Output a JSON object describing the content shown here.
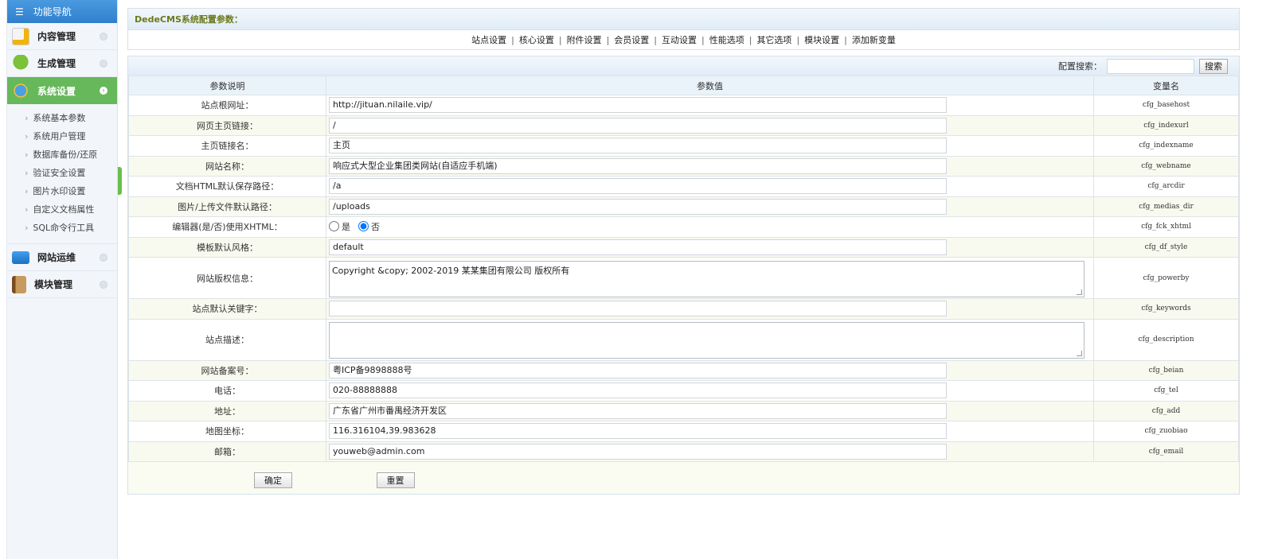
{
  "sidebar": {
    "title": "功能导航",
    "items": [
      {
        "label": "内容管理"
      },
      {
        "label": "生成管理"
      },
      {
        "label": "系统设置"
      },
      {
        "label": "网站运维"
      },
      {
        "label": "模块管理"
      }
    ],
    "submenu": [
      "系统基本参数",
      "系统用户管理",
      "数据库备份/还原",
      "验证安全设置",
      "图片水印设置",
      "自定义文档属性",
      "SQL命令行工具"
    ]
  },
  "header": {
    "title": "DedeCMS系统配置参数：",
    "tabs": [
      "站点设置",
      "核心设置",
      "附件设置",
      "会员设置",
      "互动设置",
      "性能选项",
      "其它选项",
      "模块设置",
      "添加新变量"
    ]
  },
  "search": {
    "label": "配置搜索：",
    "value": "",
    "button": "搜索"
  },
  "table": {
    "columns": [
      "参数说明",
      "参数值",
      "变量名"
    ],
    "rows": [
      {
        "label": "站点根网址：",
        "value": "http://jituan.nilaile.vip/",
        "var": "cfg_basehost",
        "type": "text"
      },
      {
        "label": "网页主页链接：",
        "value": "/",
        "var": "cfg_indexurl",
        "type": "text"
      },
      {
        "label": "主页链接名：",
        "value": "主页",
        "var": "cfg_indexname",
        "type": "text"
      },
      {
        "label": "网站名称：",
        "value": "响应式大型企业集团类网站(自适应手机端)",
        "var": "cfg_webname",
        "type": "text"
      },
      {
        "label": "文档HTML默认保存路径：",
        "value": "/a",
        "var": "cfg_arcdir",
        "type": "text"
      },
      {
        "label": "图片/上传文件默认路径：",
        "value": "/uploads",
        "var": "cfg_medias_dir",
        "type": "text"
      },
      {
        "label": "编辑器(是/否)使用XHTML：",
        "value": "否",
        "var": "cfg_fck_xhtml",
        "type": "radio",
        "options": [
          "是",
          "否"
        ]
      },
      {
        "label": "模板默认风格：",
        "value": "default",
        "var": "cfg_df_style",
        "type": "text"
      },
      {
        "label": "网站版权信息：",
        "value": "Copyright &copy; 2002-2019 某某集团有限公司 版权所有",
        "var": "cfg_powerby",
        "type": "textarea"
      },
      {
        "label": "站点默认关键字：",
        "value": "",
        "var": "cfg_keywords",
        "type": "text"
      },
      {
        "label": "站点描述：",
        "value": "",
        "var": "cfg_description",
        "type": "textarea"
      },
      {
        "label": "网站备案号：",
        "value": "粤ICP备9898888号",
        "var": "cfg_beian",
        "type": "text"
      },
      {
        "label": "电话：",
        "value": "020-88888888",
        "var": "cfg_tel",
        "type": "text"
      },
      {
        "label": "地址：",
        "value": "广东省广州市番禺经济开发区",
        "var": "cfg_add",
        "type": "text"
      },
      {
        "label": "地图坐标：",
        "value": "116.316104,39.983628",
        "var": "cfg_zuobiao",
        "type": "text"
      },
      {
        "label": "邮箱：",
        "value": "youweb@admin.com",
        "var": "cfg_email",
        "type": "text"
      }
    ]
  },
  "buttons": {
    "ok": "确定",
    "reset": "重置"
  },
  "colors": {
    "nav_blue": "#3a8ad6",
    "active_green": "#66b85a",
    "title_olive": "#6b7a1c"
  }
}
